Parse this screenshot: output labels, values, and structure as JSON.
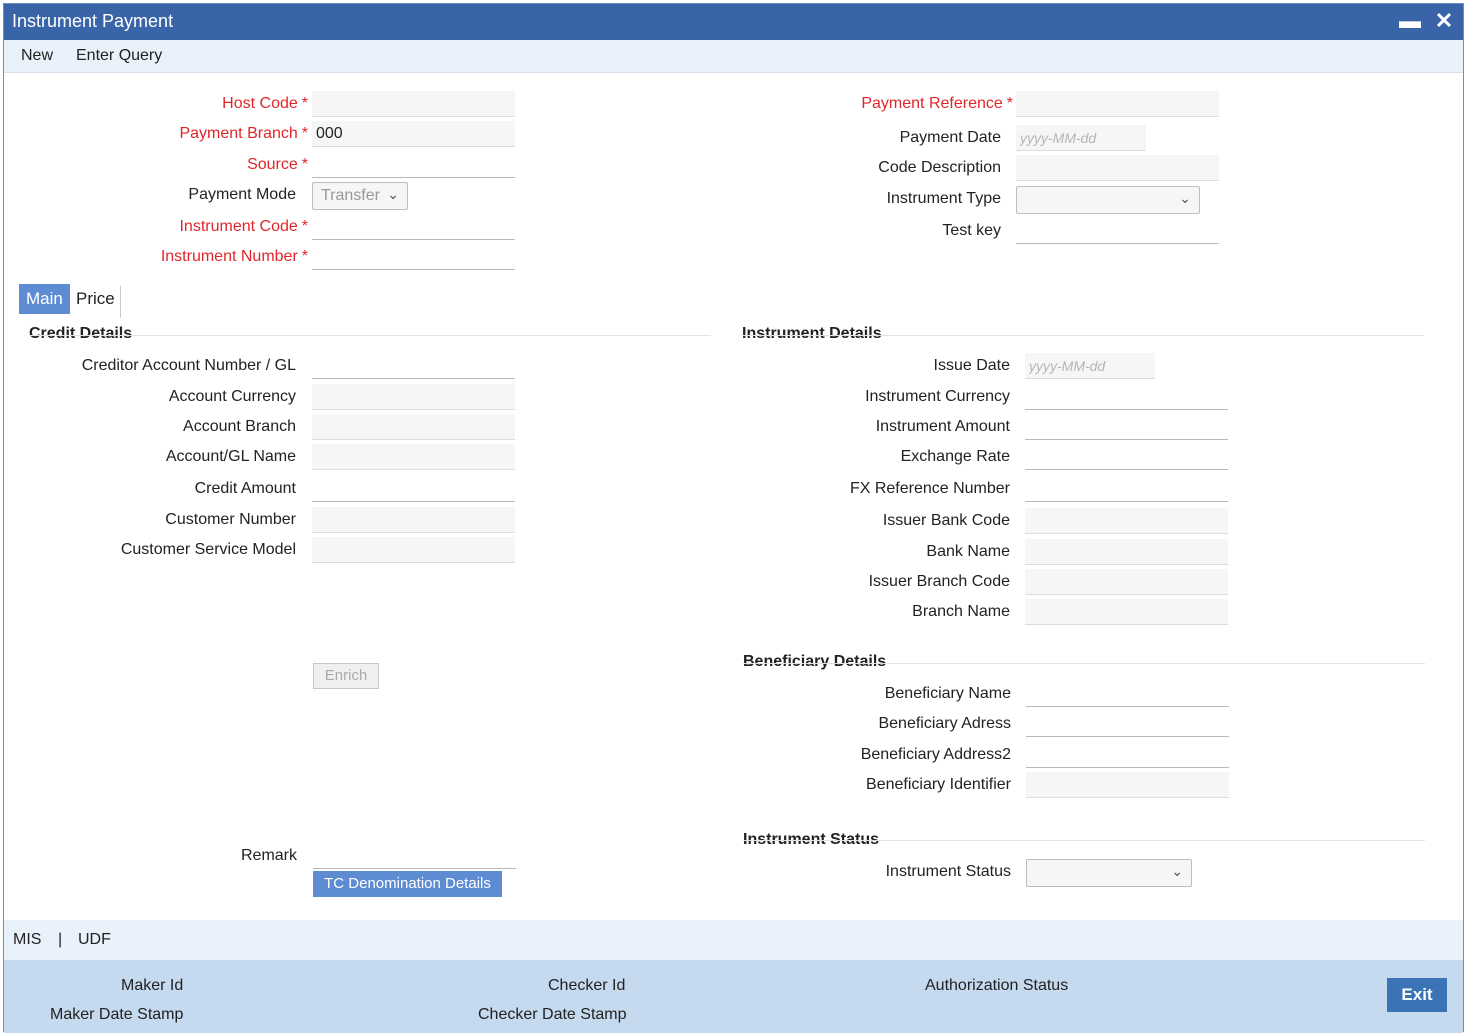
{
  "window": {
    "title": "Instrument Payment",
    "minimize_icon": "minimize-icon",
    "close_icon": "close-icon"
  },
  "menu": {
    "new": "New",
    "enter_query": "Enter Query"
  },
  "header": {
    "host_code": {
      "label": "Host Code",
      "value": ""
    },
    "payment_branch": {
      "label": "Payment Branch",
      "value": "000"
    },
    "source": {
      "label": "Source",
      "value": ""
    },
    "payment_mode": {
      "label": "Payment Mode",
      "value": "Transfer"
    },
    "instrument_code": {
      "label": "Instrument Code",
      "value": ""
    },
    "instrument_number": {
      "label": "Instrument Number",
      "value": ""
    },
    "payment_reference": {
      "label": "Payment Reference",
      "value": ""
    },
    "payment_date": {
      "label": "Payment Date",
      "placeholder": "yyyy-MM-dd"
    },
    "code_description": {
      "label": "Code Description",
      "value": ""
    },
    "instrument_type": {
      "label": "Instrument Type",
      "value": ""
    },
    "test_key": {
      "label": "Test key",
      "value": ""
    },
    "required_marker": "*"
  },
  "tabs": [
    {
      "label": "Main",
      "active": true
    },
    {
      "label": "Price",
      "active": false
    }
  ],
  "credit_details": {
    "title": "Credit Details",
    "creditor_account": "Creditor Account Number / GL",
    "account_currency": "Account Currency",
    "account_branch": "Account Branch",
    "account_gl_name": "Account/GL Name",
    "credit_amount": "Credit Amount",
    "customer_number": "Customer Number",
    "customer_service_model": "Customer Service Model",
    "enrich_button": "Enrich",
    "remark": "Remark",
    "tc_denomination_button": "TC Denomination Details"
  },
  "instrument_details": {
    "title": "Instrument Details",
    "issue_date": "Issue Date",
    "issue_date_placeholder": "yyyy-MM-dd",
    "instrument_currency": "Instrument Currency",
    "instrument_amount": "Instrument Amount",
    "exchange_rate": "Exchange Rate",
    "fx_reference_number": "FX Reference Number",
    "issuer_bank_code": "Issuer Bank Code",
    "bank_name": "Bank Name",
    "issuer_branch_code": "Issuer Branch Code",
    "branch_name": "Branch Name"
  },
  "beneficiary_details": {
    "title": "Beneficiary Details",
    "name": "Beneficiary Name",
    "address": "Beneficiary Adress",
    "address2": "Beneficiary Address2",
    "identifier": "Beneficiary Identifier"
  },
  "instrument_status": {
    "title": "Instrument Status",
    "label": "Instrument Status",
    "value": ""
  },
  "bottom_links": {
    "mis": "MIS",
    "separator": "|",
    "udf": "UDF"
  },
  "footer": {
    "maker_id": "Maker Id",
    "maker_date_stamp": "Maker Date Stamp",
    "checker_id": "Checker Id",
    "checker_date_stamp": "Checker Date Stamp",
    "authorization_status": "Authorization Status",
    "exit_button": "Exit"
  },
  "colors": {
    "title_bar": "#3a64a8",
    "required": "#e0262b",
    "accent": "#5d8cd3",
    "footer": "#c5d9ef"
  }
}
